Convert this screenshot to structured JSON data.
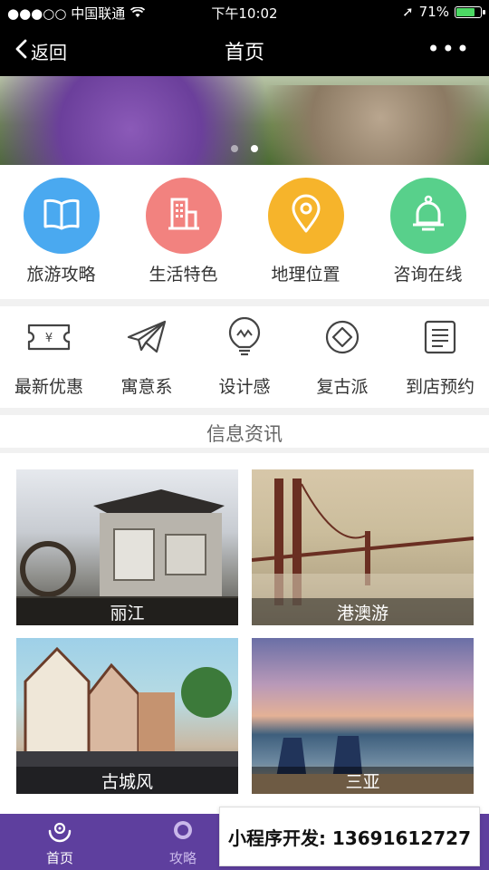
{
  "status": {
    "carrier": "●●●○○ 中国联通",
    "time": "下午10:02",
    "battery": "71%",
    "battery_level": 0.71
  },
  "nav": {
    "back": "返回",
    "title": "首页",
    "more": "•••"
  },
  "categories": [
    {
      "label": "旅游攻略",
      "icon": "book-icon",
      "color": "#4aa9f0"
    },
    {
      "label": "生活特色",
      "icon": "building-icon",
      "color": "#f2827f"
    },
    {
      "label": "地理位置",
      "icon": "location-pin-icon",
      "color": "#f6b42b"
    },
    {
      "label": "咨询在线",
      "icon": "bell-icon",
      "color": "#58d08b"
    }
  ],
  "features": [
    {
      "label": "最新优惠",
      "icon": "coupon-icon"
    },
    {
      "label": "寓意系",
      "icon": "paper-plane-icon"
    },
    {
      "label": "设计感",
      "icon": "lightbulb-icon"
    },
    {
      "label": "复古派",
      "icon": "diamond-icon"
    },
    {
      "label": "到店预约",
      "icon": "document-icon"
    }
  ],
  "info": {
    "title": "信息资讯"
  },
  "cards": [
    {
      "label": "丽江"
    },
    {
      "label": "港澳游"
    },
    {
      "label": "古城风"
    },
    {
      "label": "三亚"
    }
  ],
  "tabs": [
    {
      "label": "首页",
      "icon": "home-icon"
    },
    {
      "label": "攻略",
      "icon": "guide-icon"
    }
  ],
  "promo": {
    "text": "小程序开发: 13691612727"
  }
}
